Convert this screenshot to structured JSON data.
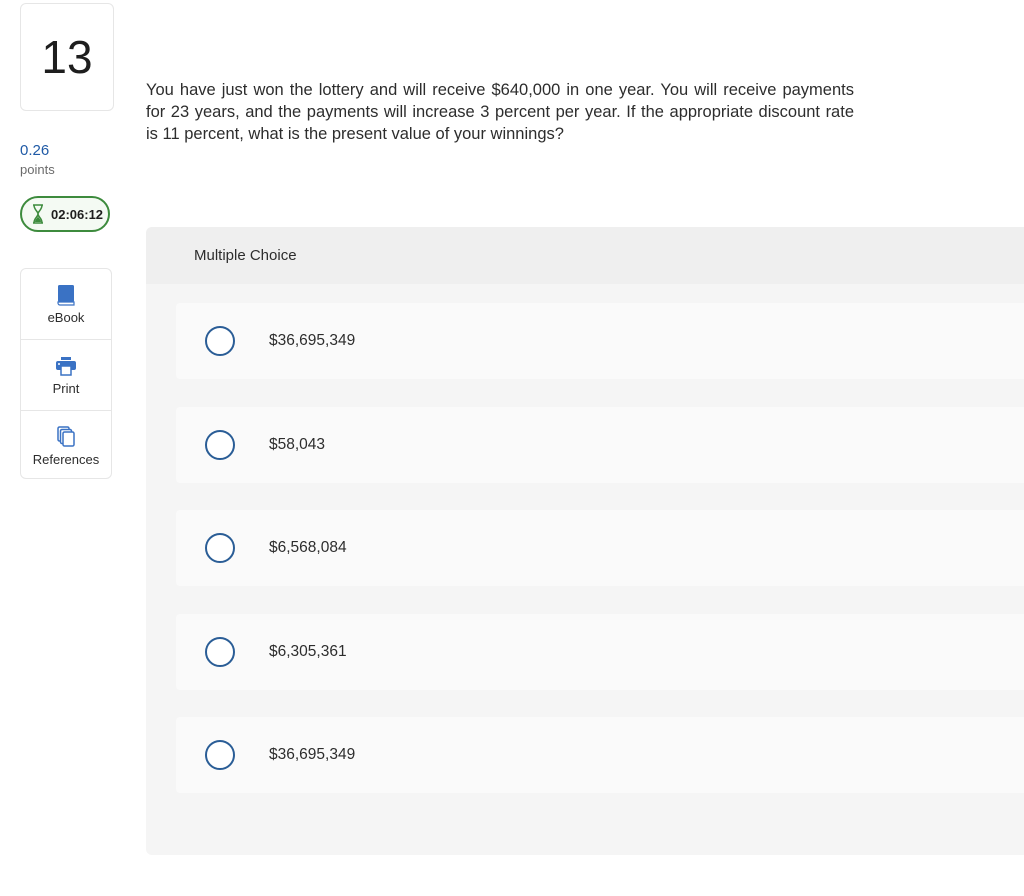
{
  "question_number": "13",
  "points": {
    "value": "0.26",
    "label": "points"
  },
  "timer": {
    "icon": "hourglass-icon",
    "value": "02:06:12",
    "color": "#3d8b3d"
  },
  "tools": [
    {
      "label": "eBook",
      "icon": "book-icon"
    },
    {
      "label": "Print",
      "icon": "printer-icon"
    },
    {
      "label": "References",
      "icon": "documents-icon"
    }
  ],
  "question_text": "You have just won the lottery and will receive $640,000 in one year. You will receive payments for 23 years, and the payments will increase 3 percent per year. If the appropriate discount rate is 11 percent, what is the present value of your winnings?",
  "multiple_choice": {
    "header": "Multiple Choice",
    "options": [
      {
        "label": "$36,695,349",
        "selected": false
      },
      {
        "label": "$58,043",
        "selected": false
      },
      {
        "label": "$6,568,084",
        "selected": false
      },
      {
        "label": "$6,305,361",
        "selected": false
      },
      {
        "label": "$36,695,349",
        "selected": false
      }
    ]
  },
  "colors": {
    "accent": "#1f5aa6",
    "radio_border": "#2a5d96",
    "icon_blue": "#3a72c4"
  }
}
